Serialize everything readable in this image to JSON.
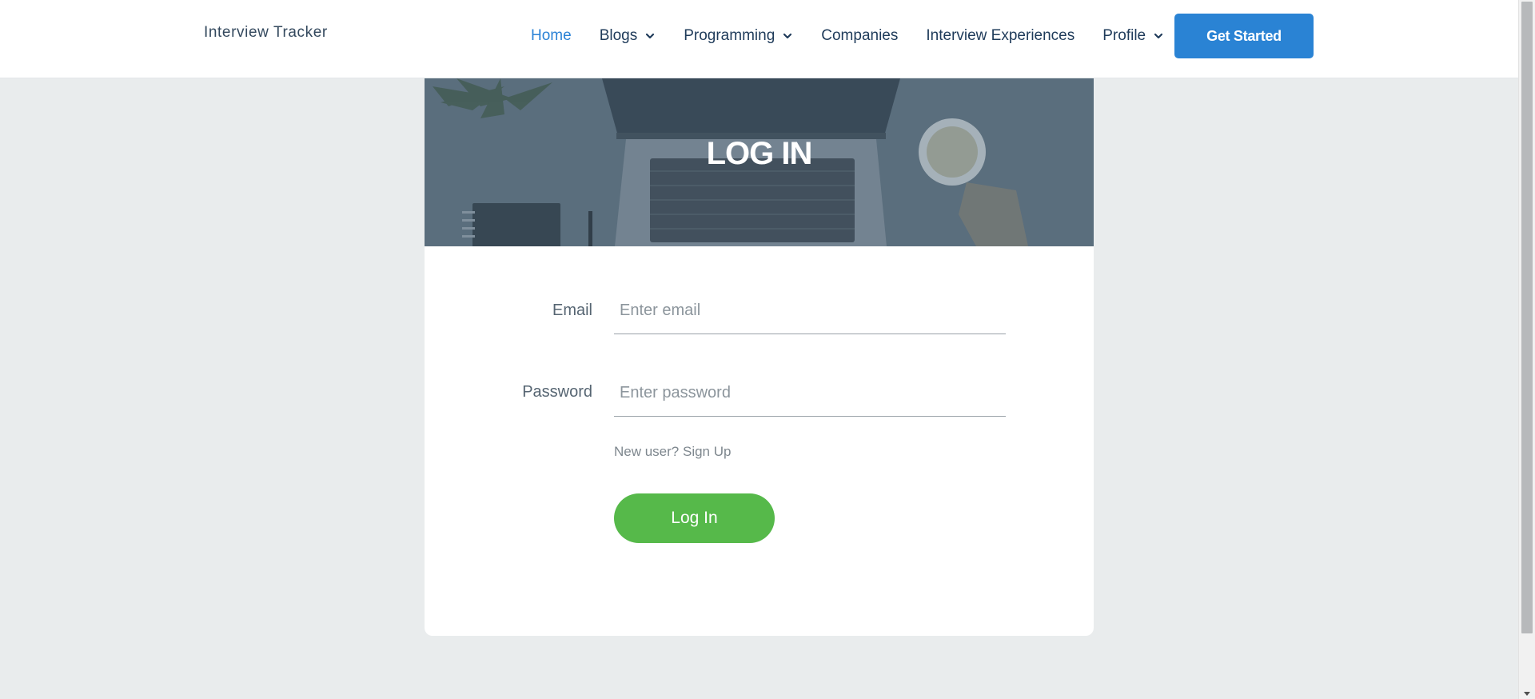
{
  "header": {
    "brand": "Interview Tracker",
    "nav": [
      {
        "label": "Home",
        "active": true,
        "dropdown": false
      },
      {
        "label": "Blogs",
        "active": false,
        "dropdown": true
      },
      {
        "label": "Programming",
        "active": false,
        "dropdown": true
      },
      {
        "label": "Companies",
        "active": false,
        "dropdown": false
      },
      {
        "label": "Interview Experiences",
        "active": false,
        "dropdown": false
      },
      {
        "label": "Profile",
        "active": false,
        "dropdown": true
      }
    ],
    "cta_label": "Get Started"
  },
  "login": {
    "title": "LOG IN",
    "email_label": "Email",
    "email_placeholder": "Enter email",
    "email_value": "",
    "password_label": "Password",
    "password_placeholder": "Enter password",
    "password_value": "",
    "signup_text": "New user? Sign Up",
    "submit_label": "Log In"
  },
  "icons": {
    "dropdown": "chevron-down-icon"
  },
  "colors": {
    "accent_blue": "#2a83d4",
    "nav_active": "#2a82d6",
    "login_green": "#56b94a",
    "page_background": "#e9eced",
    "hero_overlay": "#5e707d"
  }
}
